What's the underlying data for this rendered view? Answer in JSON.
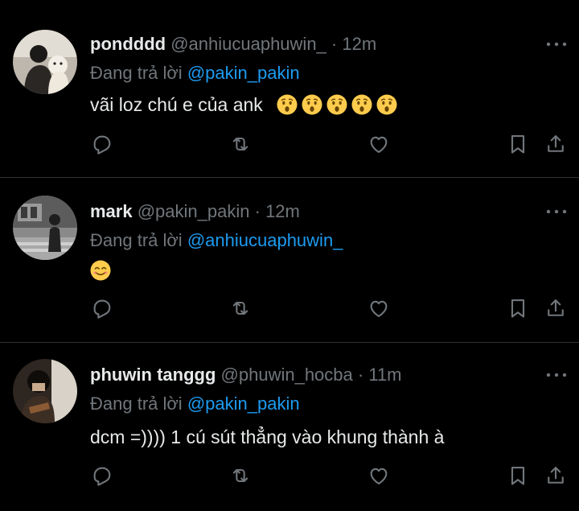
{
  "tweets": [
    {
      "name": "pondddd",
      "handle": "@anhiucuaphuwin_",
      "dot": "·",
      "time": "12m",
      "reply_prefix": "Đang trả lời",
      "reply_to": "@pakin_pakin",
      "text": "vãi loz chú e của ank",
      "emoji": [
        "hushed-face",
        "hushed-face",
        "hushed-face",
        "hushed-face",
        "hushed-face"
      ]
    },
    {
      "name": "mark",
      "handle": "@pakin_pakin",
      "dot": "·",
      "time": "12m",
      "reply_prefix": "Đang trả lời",
      "reply_to": "@anhiucuaphuwin_",
      "text": "",
      "emoji": [
        "smiling-face"
      ]
    },
    {
      "name": "phuwin tanggg",
      "handle": "@phuwin_hocba",
      "dot": "·",
      "time": "11m",
      "reply_prefix": "Đang trả lời",
      "reply_to": "@pakin_pakin",
      "text": "dcm =)))) 1 cú sút thẳng vào khung thành à",
      "emoji": []
    }
  ],
  "icons": {
    "actions": [
      "reply-icon",
      "retweet-icon",
      "like-icon",
      "bookmark-icon",
      "share-icon"
    ],
    "more": "more-icon"
  },
  "colors": {
    "background": "#000000",
    "text": "#e7e9ea",
    "muted": "#71767b",
    "link": "#1d9bf0",
    "divider": "#2f3336",
    "emoji": "#ffcc4d"
  }
}
